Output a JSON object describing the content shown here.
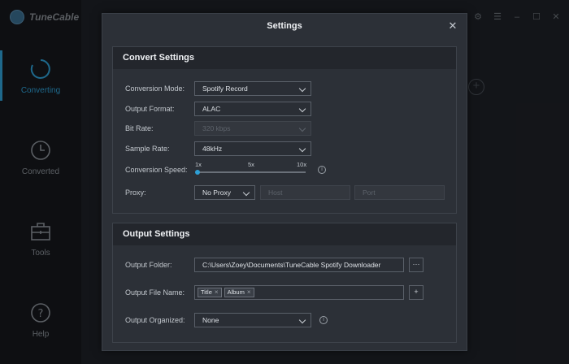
{
  "app": {
    "brand_name": "TuneCable",
    "nav": [
      {
        "label": "Converting"
      },
      {
        "label": "Converted"
      },
      {
        "label": "Tools"
      },
      {
        "label": "Help"
      }
    ]
  },
  "modal": {
    "title": "Settings",
    "convert_section": {
      "heading": "Convert Settings",
      "conversion_mode": {
        "label": "Conversion Mode:",
        "value": "Spotify Record"
      },
      "output_format": {
        "label": "Output Format:",
        "value": "ALAC"
      },
      "bit_rate": {
        "label": "Bit Rate:",
        "value": "320 kbps"
      },
      "sample_rate": {
        "label": "Sample Rate:",
        "value": "48kHz"
      },
      "conversion_speed": {
        "label": "Conversion Speed:",
        "ticks": [
          "1x",
          "5x",
          "10x"
        ],
        "value": "1x",
        "level": 0
      },
      "proxy": {
        "label": "Proxy:",
        "value": "No Proxy",
        "host_placeholder": "Host",
        "port_placeholder": "Port"
      }
    },
    "output_section": {
      "heading": "Output Settings",
      "output_folder": {
        "label": "Output Folder:",
        "value": "C:\\Users\\Zoey\\Documents\\TuneCable Spotify Downloader",
        "browse": "···"
      },
      "output_file_name": {
        "label": "Output File Name:",
        "tags": [
          "Title",
          "Album"
        ],
        "add": "+"
      },
      "output_organized": {
        "label": "Output Organized:",
        "value": "None"
      }
    }
  },
  "colors": {
    "accent": "#2ea0d6",
    "modal_bg": "#2c3037",
    "section_head_bg": "#23262c"
  }
}
